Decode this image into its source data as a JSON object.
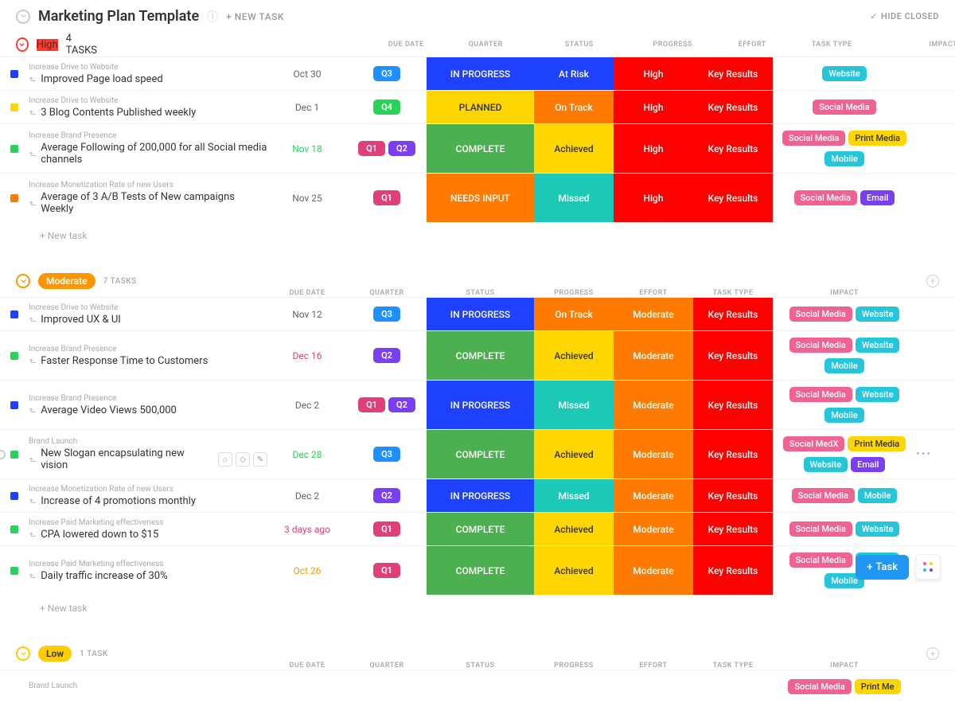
{
  "header": {
    "title": "Marketing Plan Template",
    "new_task": "+ NEW TASK",
    "hide_closed": "HIDE CLOSED"
  },
  "columns": {
    "due": "DUE DATE",
    "quarter": "QUARTER",
    "status": "STATUS",
    "progress": "PROGRESS",
    "effort": "EFFORT",
    "type": "TASK TYPE",
    "impact": "IMPACT"
  },
  "new_task_label": "+ New task",
  "priorities": {
    "high": {
      "label": "High",
      "count": "4 TASKS",
      "color": "#ff3b30"
    },
    "moderate": {
      "label": "Moderate",
      "count": "7 TASKS",
      "color": "#ff9500"
    },
    "low": {
      "label": "Low",
      "count": "1 TASK",
      "color": "#ffcc00"
    }
  },
  "statuses": {
    "ip": "IN PROGRESS",
    "pl": "PLANNED",
    "co": "COMPLETE",
    "ni": "NEEDS INPUT"
  },
  "progress": {
    "risk": "At Risk",
    "ontrack": "On Track",
    "ach": "Achieved",
    "miss": "Missed"
  },
  "effort": {
    "high": "High",
    "mod": "Moderate"
  },
  "type": {
    "kr": "Key Results"
  },
  "tags": {
    "sm": "Social Media",
    "web": "Website",
    "pm": "Print Media",
    "mob": "Mobile",
    "em": "Email",
    "smx": "Social MedX",
    "pmcut": "Print Me"
  },
  "tasks_high": [
    {
      "parent": "Increase Drive to Website",
      "title": "Improved Page load speed",
      "due": "Oct 30",
      "due_cls": "",
      "qtrs": [
        "Q3"
      ],
      "status": "ip",
      "prog": "risk",
      "eff": "high",
      "type": "kr",
      "tags": [
        "web"
      ],
      "dot": "blue",
      "tall": false
    },
    {
      "parent": "Increase Drive to Website",
      "title": "3 Blog Contents Published weekly",
      "due": "Dec 1",
      "due_cls": "",
      "qtrs": [
        "Q4"
      ],
      "status": "pl",
      "prog": "ontrack",
      "eff": "high",
      "type": "kr",
      "tags": [
        "sm"
      ],
      "dot": "yellow",
      "tall": false
    },
    {
      "parent": "Increase Brand Presence",
      "title": "Average Following of 200,000 for all Social media channels",
      "due": "Nov 18",
      "due_cls": "green",
      "qtrs": [
        "Q1",
        "Q2"
      ],
      "status": "co",
      "prog": "ach",
      "eff": "high",
      "type": "kr",
      "tags": [
        "sm",
        "pm",
        "mob"
      ],
      "dot": "green",
      "tall": true
    },
    {
      "parent": "Increase Monetization Rate of new Users",
      "title": "Average of 3 A/B Tests of New campaigns Weekly",
      "due": "Nov 25",
      "due_cls": "",
      "qtrs": [
        "Q1"
      ],
      "status": "ni",
      "prog": "miss",
      "eff": "high",
      "type": "kr",
      "tags": [
        "sm",
        "em"
      ],
      "dot": "orange",
      "tall": true
    }
  ],
  "tasks_mod": [
    {
      "parent": "Increase Drive to Website",
      "title": "Improved UX & UI",
      "due": "Nov 12",
      "due_cls": "",
      "qtrs": [
        "Q3"
      ],
      "status": "ip",
      "prog": "ontrack",
      "eff": "mod",
      "type": "kr",
      "tags": [
        "sm",
        "web"
      ],
      "dot": "blue",
      "tall": false
    },
    {
      "parent": "Increase Brand Presence",
      "title": "Faster Response Time to Customers",
      "due": "Dec 16",
      "due_cls": "red",
      "qtrs": [
        "Q2"
      ],
      "status": "co",
      "prog": "ach",
      "eff": "mod",
      "type": "kr",
      "tags": [
        "sm",
        "web",
        "mob"
      ],
      "dot": "green",
      "tall": true
    },
    {
      "parent": "Increase Brand Presence",
      "title": "Average Video Views 500,000",
      "due": "Dec 2",
      "due_cls": "",
      "qtrs": [
        "Q1",
        "Q2"
      ],
      "status": "ip",
      "prog": "miss",
      "eff": "mod",
      "type": "kr",
      "tags": [
        "sm",
        "web",
        "mob"
      ],
      "dot": "blue",
      "tall": true
    },
    {
      "parent": "Brand Launch",
      "title": "New Slogan encapsulating new vision",
      "due": "Dec 28",
      "due_cls": "green",
      "qtrs": [
        "Q3"
      ],
      "status": "co",
      "prog": "ach",
      "eff": "mod",
      "type": "kr",
      "tags": [
        "smx",
        "pm",
        "web",
        "em"
      ],
      "dot": "green",
      "tall": true,
      "hovered": true
    },
    {
      "parent": "Increase Monetization Rate of new Users",
      "title": "Increase of 4 promotions monthly",
      "due": "Dec 2",
      "due_cls": "",
      "qtrs": [
        "Q2"
      ],
      "status": "ip",
      "prog": "miss",
      "eff": "mod",
      "type": "kr",
      "tags": [
        "sm",
        "mob"
      ],
      "dot": "blue",
      "tall": false
    },
    {
      "parent": "Increase Paid Marketing effectiveness",
      "title": "CPA lowered down to $15",
      "due": "3 days ago",
      "due_cls": "red",
      "qtrs": [
        "Q1"
      ],
      "status": "co",
      "prog": "ach",
      "eff": "mod",
      "type": "kr",
      "tags": [
        "sm",
        "web"
      ],
      "dot": "green",
      "tall": false
    },
    {
      "parent": "Increase Paid Marketing effectiveness",
      "title": "Daily traffic increase of 30%",
      "due": "Oct 26",
      "due_cls": "orange",
      "qtrs": [
        "Q1"
      ],
      "status": "co",
      "prog": "ach",
      "eff": "mod",
      "type": "kr",
      "tags": [
        "sm",
        "web",
        "mob"
      ],
      "dot": "green",
      "tall": true
    }
  ],
  "tasks_low": [
    {
      "parent": "Brand Launch",
      "title": "",
      "due": "",
      "due_cls": "",
      "qtrs": [],
      "status": "",
      "prog": "",
      "eff": "",
      "type": "",
      "tags": [
        "sm",
        "pmcut"
      ],
      "dot": "",
      "tall": false
    }
  ],
  "fab": {
    "task": "Task"
  }
}
